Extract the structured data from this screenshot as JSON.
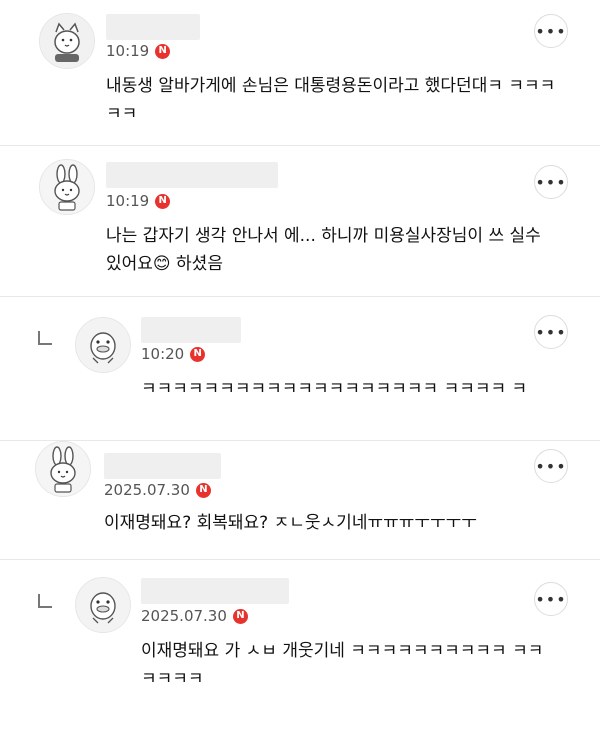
{
  "comments": [
    {
      "time": "10:19",
      "badge": "N",
      "text": "내동생 알바가게에 손님은 대통령용돈이라고 했다던대ㅋ ㅋㅋㅋㅋㅋ",
      "avatar_icon": "cat-face-icon"
    },
    {
      "time": "10:19",
      "badge": "N",
      "text": "나는 갑자기 생각 안나서 에... 하니까 미용실사장님이 쓰 실수있어요😊 하셨음",
      "avatar_icon": "rabbit-face-icon"
    },
    {
      "time": "10:20",
      "badge": "N",
      "text": "ㅋㅋㅋㅋㅋㅋㅋㅋㅋㅋㅋㅋㅋㅋㅋㅋㅋㅋㅋ ㅋㅋㅋㅋ ㅋ",
      "avatar_icon": "duck-face-icon",
      "is_reply": true
    },
    {
      "time": "2025.07.30",
      "badge": "N",
      "text": "이재명돼요? 회복돼요? ㅈㄴ웃ㅅ기네ㅠㅠㅠㅜㅜㅜㅜ",
      "avatar_icon": "rabbit-face-icon"
    },
    {
      "time": "2025.07.30",
      "badge": "N",
      "text": "이재명돼요 가 ㅅㅂ 개웃기네 ㅋㅋㅋㅋㅋㅋㅋㅋㅋㅋ ㅋㅋㅋㅋㅋㅋ",
      "avatar_icon": "duck-face-icon",
      "is_reply": true
    }
  ],
  "more_label": "•••"
}
